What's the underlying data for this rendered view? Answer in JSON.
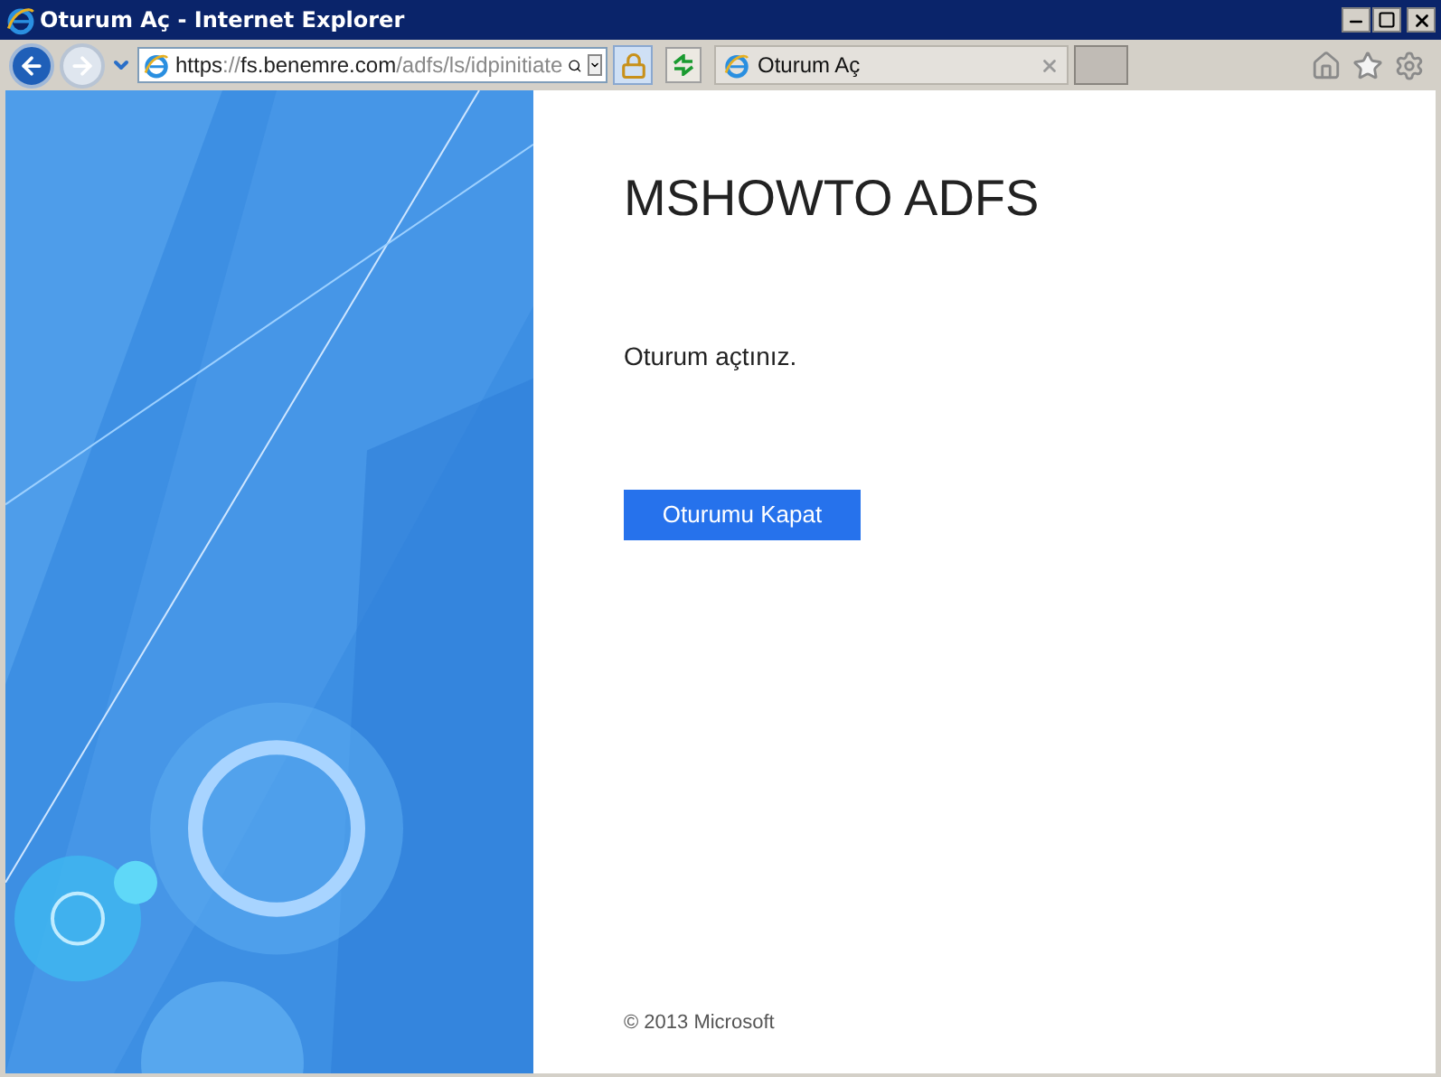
{
  "window": {
    "title": "Oturum Aç - Internet Explorer"
  },
  "address": {
    "scheme": "https",
    "separator": "://",
    "host": "fs.benemre.com",
    "path": "/adfs/ls/idpinitiate"
  },
  "tabs": [
    {
      "label": "Oturum Aç",
      "selected": true
    }
  ],
  "page": {
    "heading": "MSHOWTO ADFS",
    "message": "Oturum açtınız.",
    "button": "Oturumu Kapat",
    "footer": "© 2013 Microsoft"
  }
}
